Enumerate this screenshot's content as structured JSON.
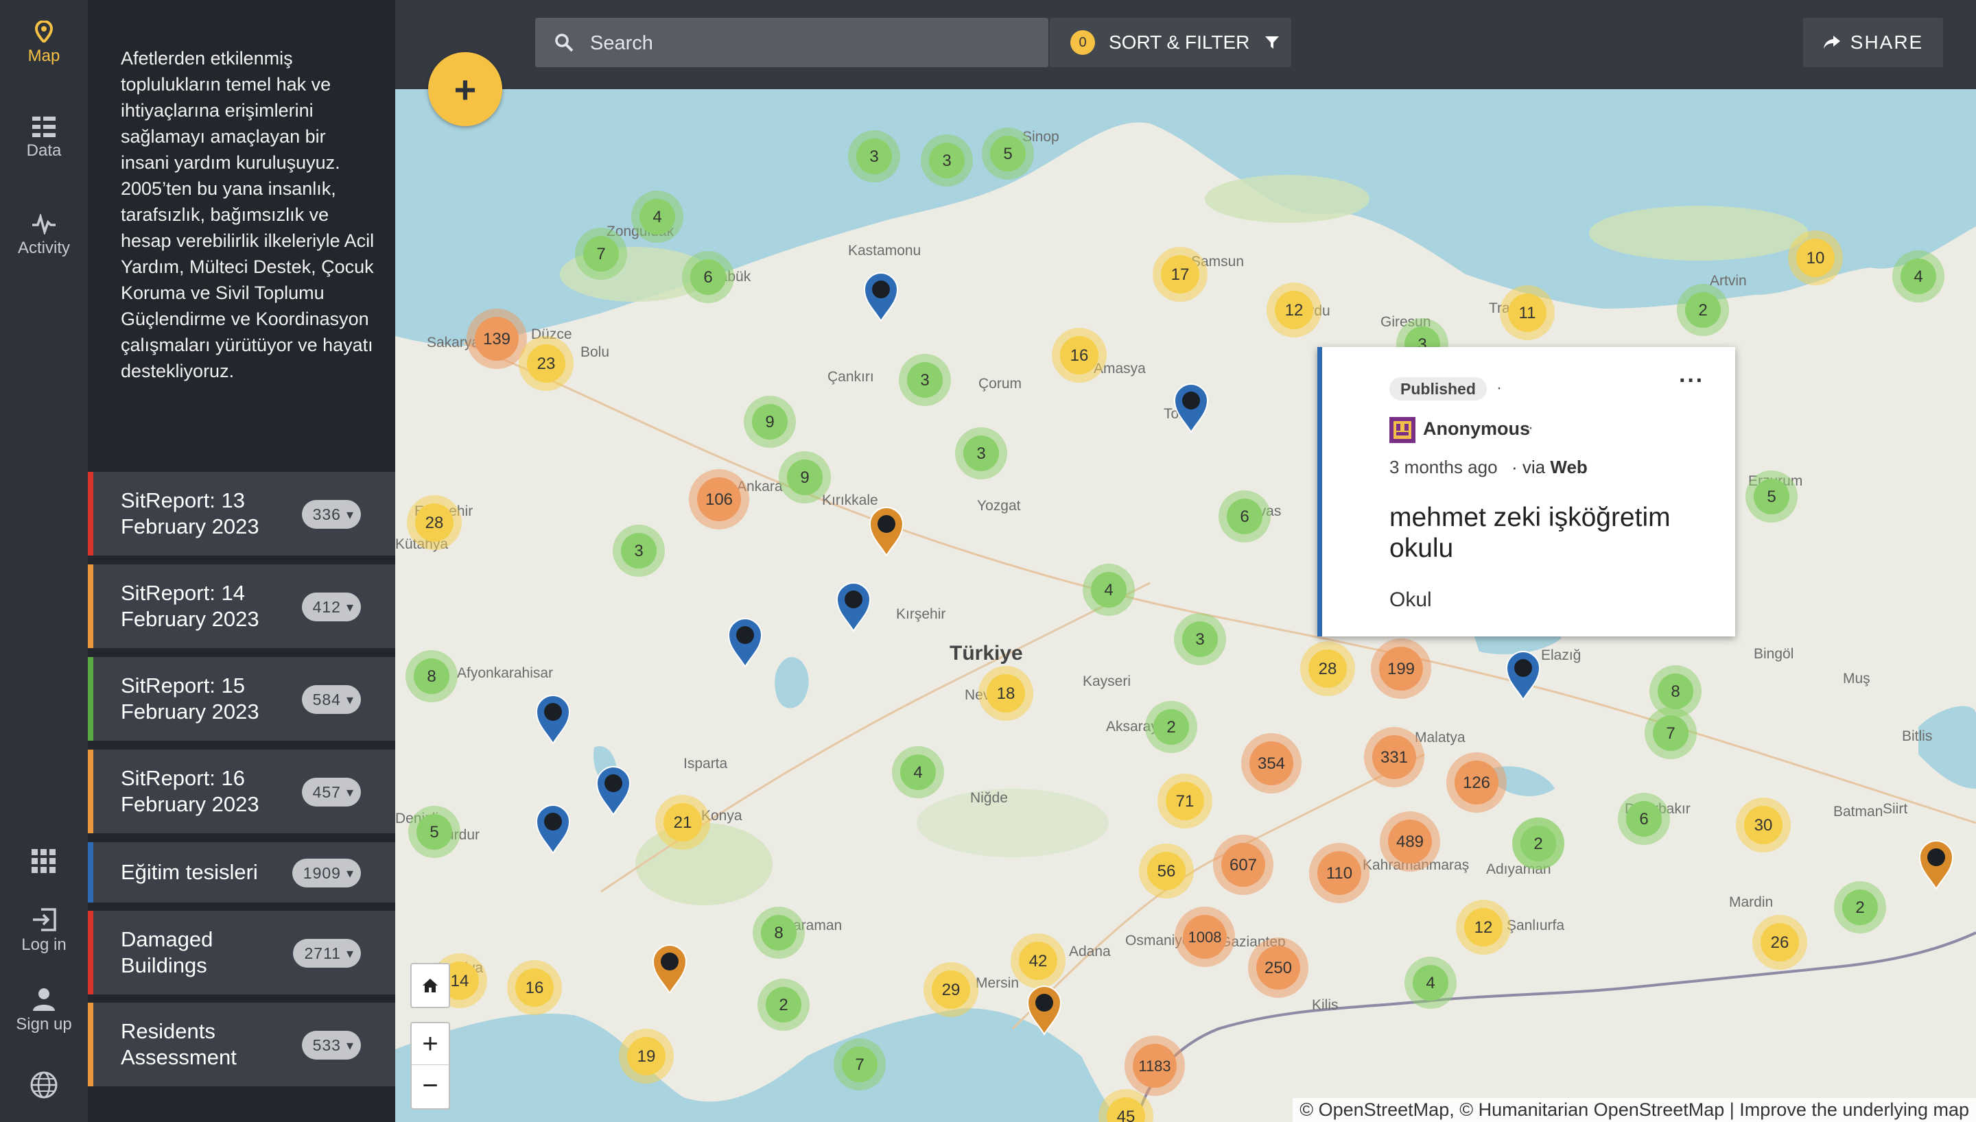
{
  "nav": {
    "items": [
      {
        "label": "Map",
        "icon": "map-pin-icon",
        "active": true
      },
      {
        "label": "Data",
        "icon": "data-list-icon",
        "active": false
      },
      {
        "label": "Activity",
        "icon": "activity-pulse-icon",
        "active": false
      }
    ],
    "bottom": [
      {
        "label": "",
        "icon": "apps-grid-icon"
      },
      {
        "label": "Log in",
        "icon": "login-icon"
      },
      {
        "label": "Sign up",
        "icon": "user-icon"
      },
      {
        "label": "",
        "icon": "globe-icon"
      }
    ]
  },
  "description": "Afetlerden etkilenmiş toplulukların temel hak ve ihtiyaçlarına erişimlerini sağlamayı amaçlayan bir insani yardım kuruluşuyuz. 2005’ten bu yana insanlık, tarafsızlık, bağımsızlık ve hesap verebilirlik ilkeleriyle Acil Yardım, Mülteci Destek, Çocuk Koruma ve Sivil Toplumu Güçlendirme ve Koordinasyon çalışmaları yürütüyor ve hayatı destekliyoruz.",
  "collections": [
    {
      "title": "SitReport: 13 February 2023",
      "count": "336",
      "color": "#d9342b"
    },
    {
      "title": "SitReport: 14 February 2023",
      "count": "412",
      "color": "#e9973c"
    },
    {
      "title": "SitReport: 15 February 2023",
      "count": "584",
      "color": "#5aa842"
    },
    {
      "title": "SitReport: 16 February 2023",
      "count": "457",
      "color": "#e9973c"
    },
    {
      "title": "Eğitim tesisleri",
      "count": "1909",
      "color": "#2d6cb5"
    },
    {
      "title": "Damaged Buildings",
      "count": "2711",
      "color": "#d9342b"
    },
    {
      "title": "Residents Assessment",
      "count": "533",
      "color": "#e9973c"
    }
  ],
  "search": {
    "placeholder": "Search"
  },
  "sort_filter": {
    "label": "SORT & FILTER",
    "count": "0"
  },
  "share": {
    "label": "SHARE"
  },
  "popup": {
    "status": "Published",
    "author": "Anonymous",
    "time": "3 months ago",
    "via_prefix": "via",
    "via_source": "Web",
    "title": "mehmet zeki işköğretim okulu",
    "category": "Okul",
    "menu_icon": "more-horizontal-icon"
  },
  "map": {
    "attribution": "© OpenStreetMap, © Humanitarian OpenStreetMap | Improve the underlying map",
    "country_label": "Türkiye",
    "place_labels": [
      "Sinop",
      "Zonguldak",
      "Kastamonu",
      "Karabük",
      "Düzce",
      "Sakarya",
      "Bolu",
      "Çankırı",
      "Çorum",
      "Amasya",
      "Samsun",
      "Ordu",
      "Giresun",
      "Trabzon",
      "Artvin",
      "Tokat",
      "Sivas",
      "Erzurum",
      "Ankara",
      "Kırıkkale",
      "Yozgat",
      "Eskişehir",
      "Kırşehir",
      "Kayseri",
      "Afyonkarahisar",
      "Aksaray",
      "Nevşehir",
      "Niğde",
      "Konya",
      "Karaman",
      "Antalya",
      "Mersin",
      "Adana",
      "Osmaniye",
      "Gaziantep",
      "Kilis",
      "Kahramanmaraş",
      "Malatya",
      "Adıyaman",
      "Elazığ",
      "Bingöl",
      "Muş",
      "Bitlis",
      "Siirt",
      "Batman",
      "Diyarbakır",
      "Mardin",
      "Şanlıurfa",
      "Isparta",
      "Burdur",
      "Denizli",
      "Kütahya"
    ],
    "clusters": [
      {
        "n": "3",
        "lvl": "g"
      },
      {
        "n": "3",
        "lvl": "g"
      },
      {
        "n": "5",
        "lvl": "g"
      },
      {
        "n": "4",
        "lvl": "g"
      },
      {
        "n": "7",
        "lvl": "g"
      },
      {
        "n": "6",
        "lvl": "g"
      },
      {
        "n": "139",
        "lvl": "o"
      },
      {
        "n": "23",
        "lvl": "y"
      },
      {
        "n": "3",
        "lvl": "g"
      },
      {
        "n": "9",
        "lvl": "g"
      },
      {
        "n": "9",
        "lvl": "g"
      },
      {
        "n": "3",
        "lvl": "g"
      },
      {
        "n": "16",
        "lvl": "y"
      },
      {
        "n": "17",
        "lvl": "y"
      },
      {
        "n": "12",
        "lvl": "y"
      },
      {
        "n": "3",
        "lvl": "g"
      },
      {
        "n": "11",
        "lvl": "y"
      },
      {
        "n": "2",
        "lvl": "g"
      },
      {
        "n": "10",
        "lvl": "y"
      },
      {
        "n": "4",
        "lvl": "g"
      },
      {
        "n": "106",
        "lvl": "o"
      },
      {
        "n": "28",
        "lvl": "y"
      },
      {
        "n": "3",
        "lvl": "g"
      },
      {
        "n": "6",
        "lvl": "g"
      },
      {
        "n": "4",
        "lvl": "g"
      },
      {
        "n": "5",
        "lvl": "g"
      },
      {
        "n": "3",
        "lvl": "g"
      },
      {
        "n": "8",
        "lvl": "g"
      },
      {
        "n": "28",
        "lvl": "y"
      },
      {
        "n": "199",
        "lvl": "o"
      },
      {
        "n": "18",
        "lvl": "y"
      },
      {
        "n": "2",
        "lvl": "g"
      },
      {
        "n": "8",
        "lvl": "g"
      },
      {
        "n": "4",
        "lvl": "g"
      },
      {
        "n": "354",
        "lvl": "o"
      },
      {
        "n": "331",
        "lvl": "o"
      },
      {
        "n": "126",
        "lvl": "o"
      },
      {
        "n": "7",
        "lvl": "g"
      },
      {
        "n": "2",
        "lvl": "g"
      },
      {
        "n": "5",
        "lvl": "g"
      },
      {
        "n": "21",
        "lvl": "y"
      },
      {
        "n": "71",
        "lvl": "y"
      },
      {
        "n": "607",
        "lvl": "o"
      },
      {
        "n": "489",
        "lvl": "o"
      },
      {
        "n": "2",
        "lvl": "g"
      },
      {
        "n": "6",
        "lvl": "g"
      },
      {
        "n": "30",
        "lvl": "y"
      },
      {
        "n": "56",
        "lvl": "y"
      },
      {
        "n": "110",
        "lvl": "o"
      },
      {
        "n": "8",
        "lvl": "g"
      },
      {
        "n": "1008",
        "lvl": "o"
      },
      {
        "n": "12",
        "lvl": "y"
      },
      {
        "n": "2",
        "lvl": "g"
      },
      {
        "n": "26",
        "lvl": "y"
      },
      {
        "n": "42",
        "lvl": "y"
      },
      {
        "n": "14",
        "lvl": "y"
      },
      {
        "n": "16",
        "lvl": "y"
      },
      {
        "n": "29",
        "lvl": "y"
      },
      {
        "n": "250",
        "lvl": "o"
      },
      {
        "n": "2",
        "lvl": "g"
      },
      {
        "n": "4",
        "lvl": "g"
      },
      {
        "n": "19",
        "lvl": "y"
      },
      {
        "n": "7",
        "lvl": "g"
      },
      {
        "n": "1183",
        "lvl": "o"
      },
      {
        "n": "45",
        "lvl": "y"
      }
    ],
    "cluster_colors": {
      "g": "#8bd06a",
      "y": "#f5cf4c",
      "o": "#ee9a5f"
    },
    "pin_colors": {
      "blue": "#2d6cb5",
      "orange": "#d98a2b"
    }
  }
}
